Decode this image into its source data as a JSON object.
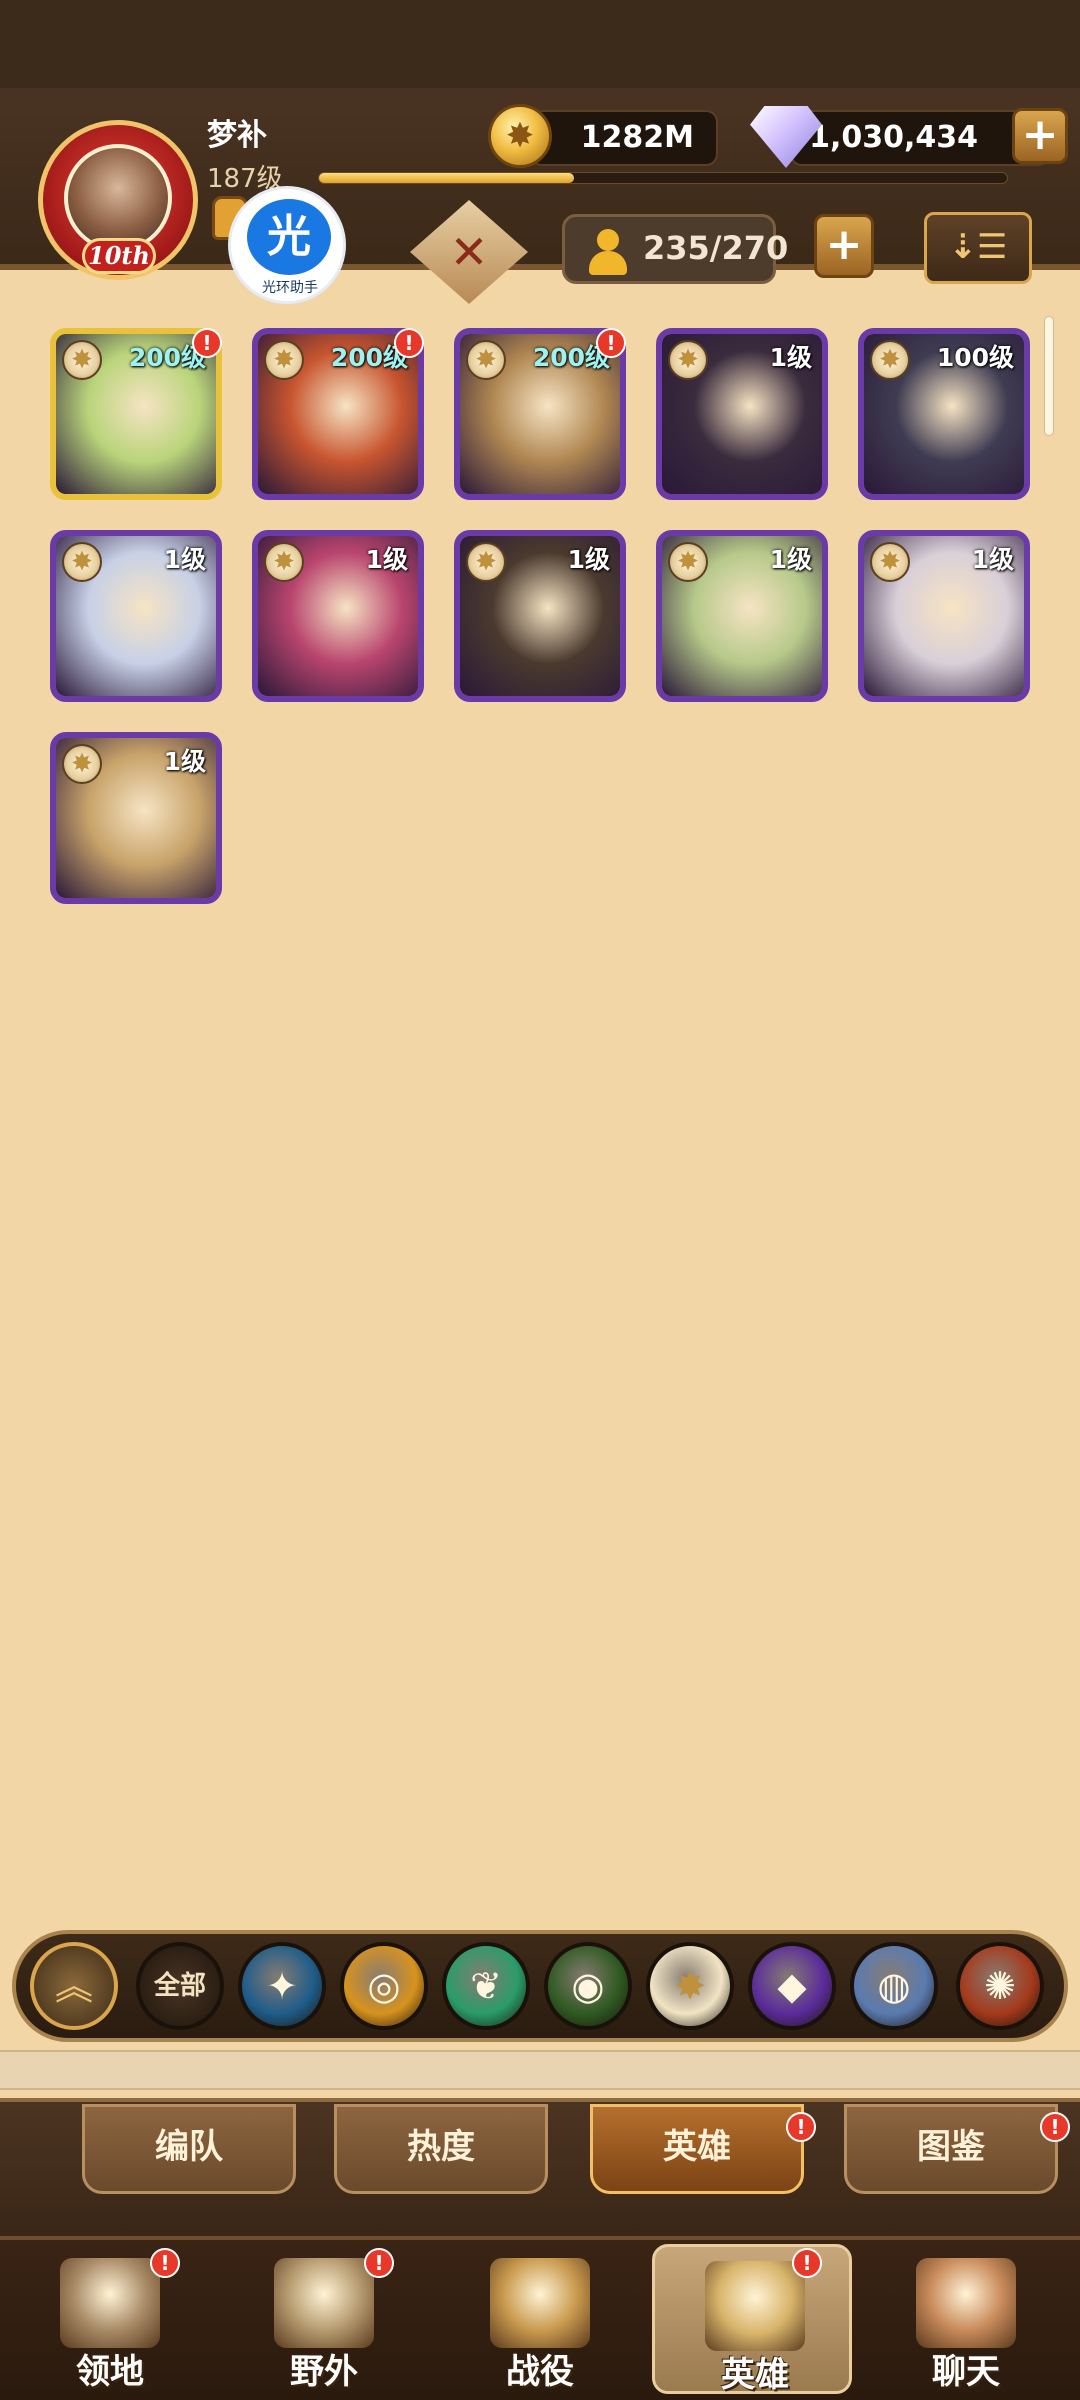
{
  "player": {
    "name": "梦补",
    "level": "187级",
    "avatar_tag": "10th",
    "xp_fraction": 0.37
  },
  "helper": {
    "glyph": "光",
    "label": "光环助手"
  },
  "resources": {
    "gold": "1282M",
    "gems": "1,030,434",
    "plus": "+"
  },
  "roster": {
    "count": "235/270",
    "plus": "+"
  },
  "sort": {
    "glyph": "⇣☰"
  },
  "heroes": [
    {
      "level": "200级",
      "level_color": "cyan",
      "frame": "gold",
      "alert": "!",
      "art": "#b9d47a"
    },
    {
      "level": "200级",
      "level_color": "cyan",
      "frame": "purple",
      "alert": "!",
      "art": "#c7552f"
    },
    {
      "level": "200级",
      "level_color": "cyan",
      "frame": "purple",
      "alert": "!",
      "art": "#b08752"
    },
    {
      "level": "1级",
      "level_color": "white",
      "frame": "purple",
      "alert": "",
      "art": "#3a2b3d"
    },
    {
      "level": "100级",
      "level_color": "white",
      "frame": "purple",
      "alert": "",
      "art": "#3f3c52"
    },
    {
      "level": "1级",
      "level_color": "white",
      "frame": "purple",
      "alert": "",
      "art": "#c7d0e6"
    },
    {
      "level": "1级",
      "level_color": "white",
      "frame": "purple",
      "alert": "",
      "art": "#b9456e"
    },
    {
      "level": "1级",
      "level_color": "white",
      "frame": "purple",
      "alert": "",
      "art": "#4a3a2e"
    },
    {
      "level": "1级",
      "level_color": "white",
      "frame": "purple",
      "alert": "",
      "art": "#b6c98a"
    },
    {
      "level": "1级",
      "level_color": "white",
      "frame": "purple",
      "alert": "",
      "art": "#d9cfd8"
    },
    {
      "level": "1级",
      "level_color": "white",
      "frame": "purple",
      "alert": "",
      "art": "#c8a36a"
    }
  ],
  "faction_filter": {
    "collapse_glyph": "︽",
    "all_label": "全部",
    "factions": [
      {
        "icon": "star-compass-icon",
        "glyph": "✦",
        "bg": "#1f5d8a"
      },
      {
        "icon": "sun-ring-icon",
        "glyph": "◎",
        "bg": "#d7931e"
      },
      {
        "icon": "leaf-icon",
        "glyph": "❦",
        "bg": "#2a9c6a"
      },
      {
        "icon": "eye-icon",
        "glyph": "◉",
        "bg": "#2f5a22"
      },
      {
        "icon": "celestial-star-icon",
        "glyph": "✸",
        "bg": "#f1e4c4"
      },
      {
        "icon": "void-crystal-icon",
        "glyph": "◆",
        "bg": "#5b2c9a"
      },
      {
        "icon": "dimensional-shield-icon",
        "glyph": "◍",
        "bg": "#5a7bb0"
      },
      {
        "icon": "flame-emblem-icon",
        "glyph": "✺",
        "bg": "#a53a1c"
      }
    ]
  },
  "sub_tabs": [
    {
      "label": "编队",
      "active": false,
      "alert": ""
    },
    {
      "label": "热度",
      "active": false,
      "alert": ""
    },
    {
      "label": "英雄",
      "active": true,
      "alert": "!"
    },
    {
      "label": "图鉴",
      "active": false,
      "alert": "!"
    }
  ],
  "bottom_nav": [
    {
      "label": "领地",
      "icon": "castle-icon",
      "active": false,
      "alert": "!",
      "art": "#a88a66"
    },
    {
      "label": "野外",
      "icon": "map-scroll-icon",
      "active": false,
      "alert": "!",
      "art": "#b59a6e"
    },
    {
      "label": "战役",
      "icon": "sword-wings-icon",
      "active": false,
      "alert": "",
      "art": "#c99a4e"
    },
    {
      "label": "英雄",
      "icon": "hero-helmet-icon",
      "active": true,
      "alert": "!",
      "art": "#d8b46a"
    },
    {
      "label": "聊天",
      "icon": "chat-bubble-icon",
      "active": false,
      "alert": "",
      "art": "#c88a5a"
    }
  ],
  "colors": {
    "accent_gold": "#d9a64e",
    "alert_red": "#e8382a",
    "page_bg": "#f2d6a6"
  }
}
